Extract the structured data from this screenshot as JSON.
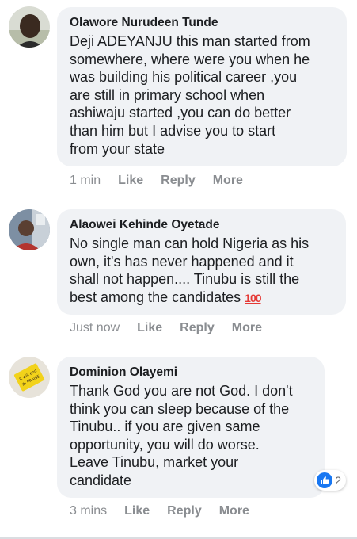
{
  "comments": [
    {
      "author": "Olawore Nurudeen Tunde",
      "text": "Deji ADEYANJU this man started from\nsomewhere, where were you when he\nwas building his political career ,you\nare still in primary school when\nashiwaju started ,you can do better\nthan him but I advise you to start\nfrom your state",
      "time": "1 min",
      "like_label": "Like",
      "reply_label": "Reply",
      "more_label": "More"
    },
    {
      "author": "Alaowei Kehinde Oyetade",
      "text": "No single man can hold Nigeria as his\nown, it's has never happened and it\nshall not happen.... Tinubu is still the\nbest among the candidates",
      "emoji": "100",
      "time": "Just now",
      "like_label": "Like",
      "reply_label": "Reply",
      "more_label": "More"
    },
    {
      "author": "Dominion Olayemi",
      "text": "Thank God you are not God. I don't\nthink you can sleep because of the\nTinubu.. if you are given same\nopportunity, you will do worse.\nLeave Tinubu, market your\ncandidate",
      "reaction_count": "2",
      "time": "3 mins",
      "like_label": "Like",
      "reply_label": "Reply",
      "more_label": "More"
    }
  ],
  "avatar3_sign_text": "It will end IN PRAISE",
  "colors": {
    "bubble": "#f0f2f5",
    "meta": "#8a8d91",
    "like_blue": "#1877f2"
  }
}
